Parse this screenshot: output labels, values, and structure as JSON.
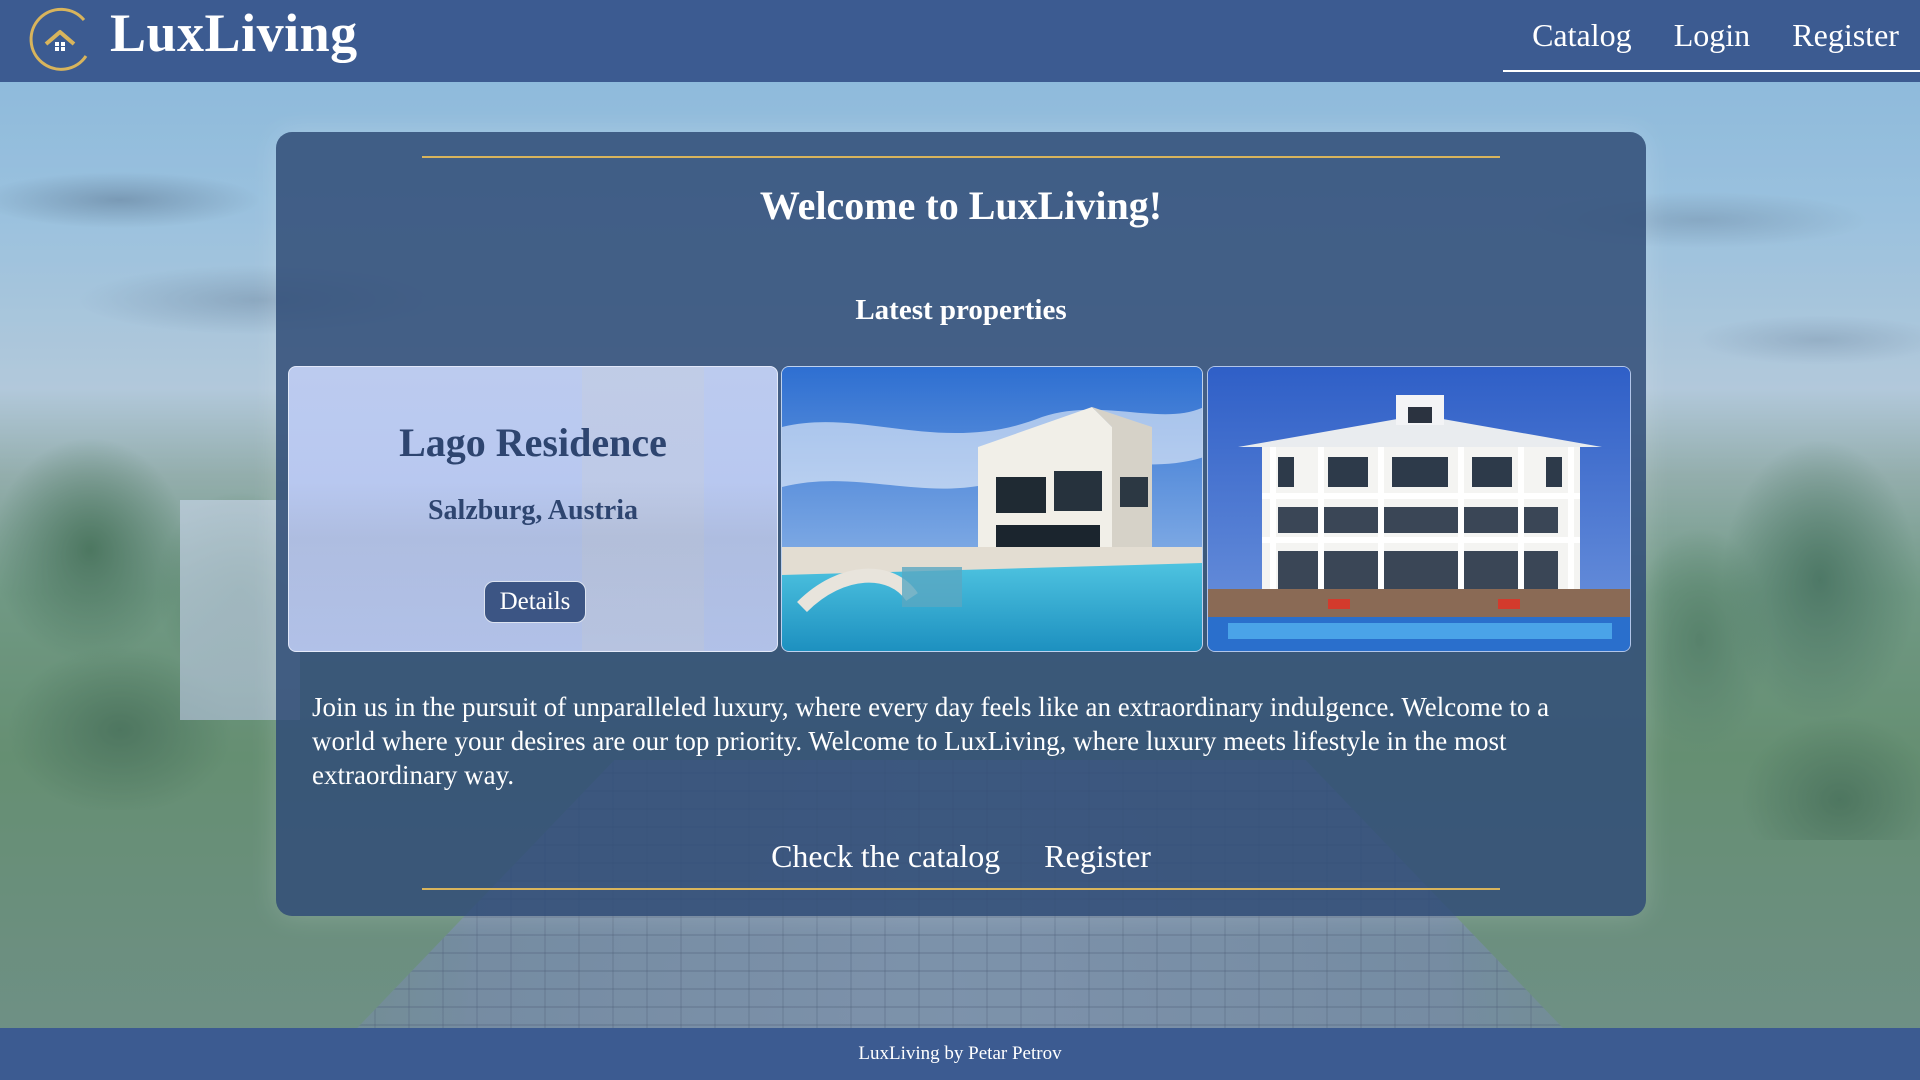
{
  "header": {
    "brand": "LuxLiving",
    "logo_icon": "house-logo-icon",
    "nav": [
      {
        "label": "Catalog"
      },
      {
        "label": "Login"
      },
      {
        "label": "Register"
      }
    ]
  },
  "main": {
    "welcome_title": "Welcome to LuxLiving!",
    "latest_heading": "Latest properties",
    "featured": {
      "title": "Lago Residence",
      "location": "Salzburg, Austria",
      "details_label": "Details"
    },
    "intro": "Join us in the pursuit of unparalleled luxury, where every day feels like an extraordinary indulgence. Welcome to a world where your desires are our top priority. Welcome to LuxLiving, where luxury meets lifestyle in the most extraordinary way.",
    "cta": {
      "catalog_label": "Check the catalog",
      "register_label": "Register"
    }
  },
  "footer": {
    "text": "LuxLiving by Petar Petrov"
  },
  "colors": {
    "header": "#3c5b91",
    "accent_gold": "#d8b45c",
    "panel": "#324e78",
    "card_title": "#2e4570"
  }
}
